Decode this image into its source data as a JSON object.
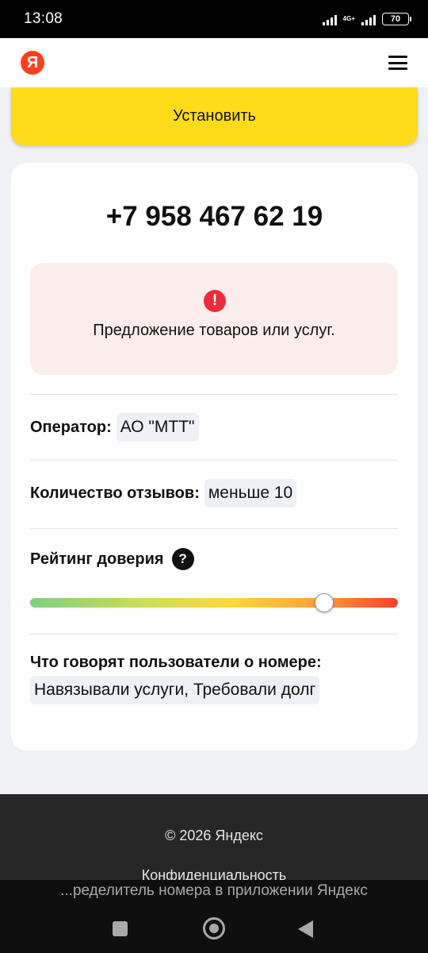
{
  "status_bar": {
    "time": "13:08",
    "network": "4G+",
    "battery": "70"
  },
  "header": {
    "logo_letter": "Я",
    "logo_color": "#fc3f1d",
    "menu_icon": "hamburger-menu-icon"
  },
  "install_button": {
    "label": "Установить",
    "color": "#ffdb1a"
  },
  "card": {
    "phone_number": "+7 958 467 62 19",
    "warning": {
      "icon": "exclamation-icon",
      "text": "Предложение товаров или услуг."
    },
    "operator": {
      "label": "Оператор:",
      "value": "АО \"МТТ\""
    },
    "reviews": {
      "label": "Количество отзывов:",
      "value": "меньше 10"
    },
    "trust_rating": {
      "label": "Рейтинг доверия",
      "help_icon": "question-icon",
      "value_fraction": 0.8
    },
    "user_reports": {
      "label": "Что говорят пользователи о номере:",
      "value": "Навязывали услуги, Требовали долг"
    }
  },
  "footer": {
    "copyright": "© 2026 Яндекс",
    "privacy": "Конфиденциальность"
  },
  "bottom_banner": {
    "text": "...ределитель номера в приложении Яндекс"
  }
}
